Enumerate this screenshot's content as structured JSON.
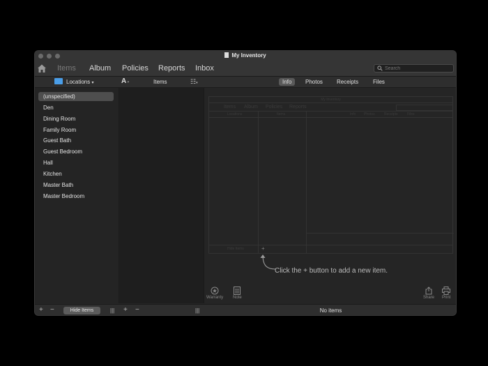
{
  "window": {
    "title": "My Inventory"
  },
  "toolbar": {
    "tabs": [
      {
        "label": "Items",
        "active": true
      },
      {
        "label": "Album"
      },
      {
        "label": "Policies"
      },
      {
        "label": "Reports"
      },
      {
        "label": "Inbox"
      }
    ],
    "search_placeholder": "Search"
  },
  "subbar": {
    "locations_label": "Locations",
    "sort_label": "A",
    "items_label": "Items",
    "detail_tabs": [
      {
        "label": "Info",
        "active": true
      },
      {
        "label": "Photos"
      },
      {
        "label": "Receipts"
      },
      {
        "label": "Files"
      }
    ]
  },
  "locations": [
    "(unspecified)",
    "Den",
    "Dining Room",
    "Family Room",
    "Guest Bath",
    "Guest Bedroom",
    "Hall",
    "Kitchen",
    "Master Bath",
    "Master Bedroom"
  ],
  "selected_location": "(unspecified)",
  "preview": {
    "title": "My Inventory",
    "tabs": [
      "Items",
      "Album",
      "Policies",
      "Reports"
    ],
    "col_locations": "Locations",
    "col_items": "Items",
    "detail_tabs": [
      "Info",
      "Photos",
      "Receipts",
      "Files"
    ],
    "hide_items": "Hide Items"
  },
  "hint": "Click the + button to add a new item.",
  "detail_tools": {
    "warranty": "Warranty",
    "note": "Note",
    "share": "Share",
    "print": "Print"
  },
  "statusbar": {
    "hide_items": "Hide Items",
    "no_items": "No items"
  },
  "colors": {
    "accent_folder": "#4a9ee8",
    "window_bg": "#262626"
  }
}
